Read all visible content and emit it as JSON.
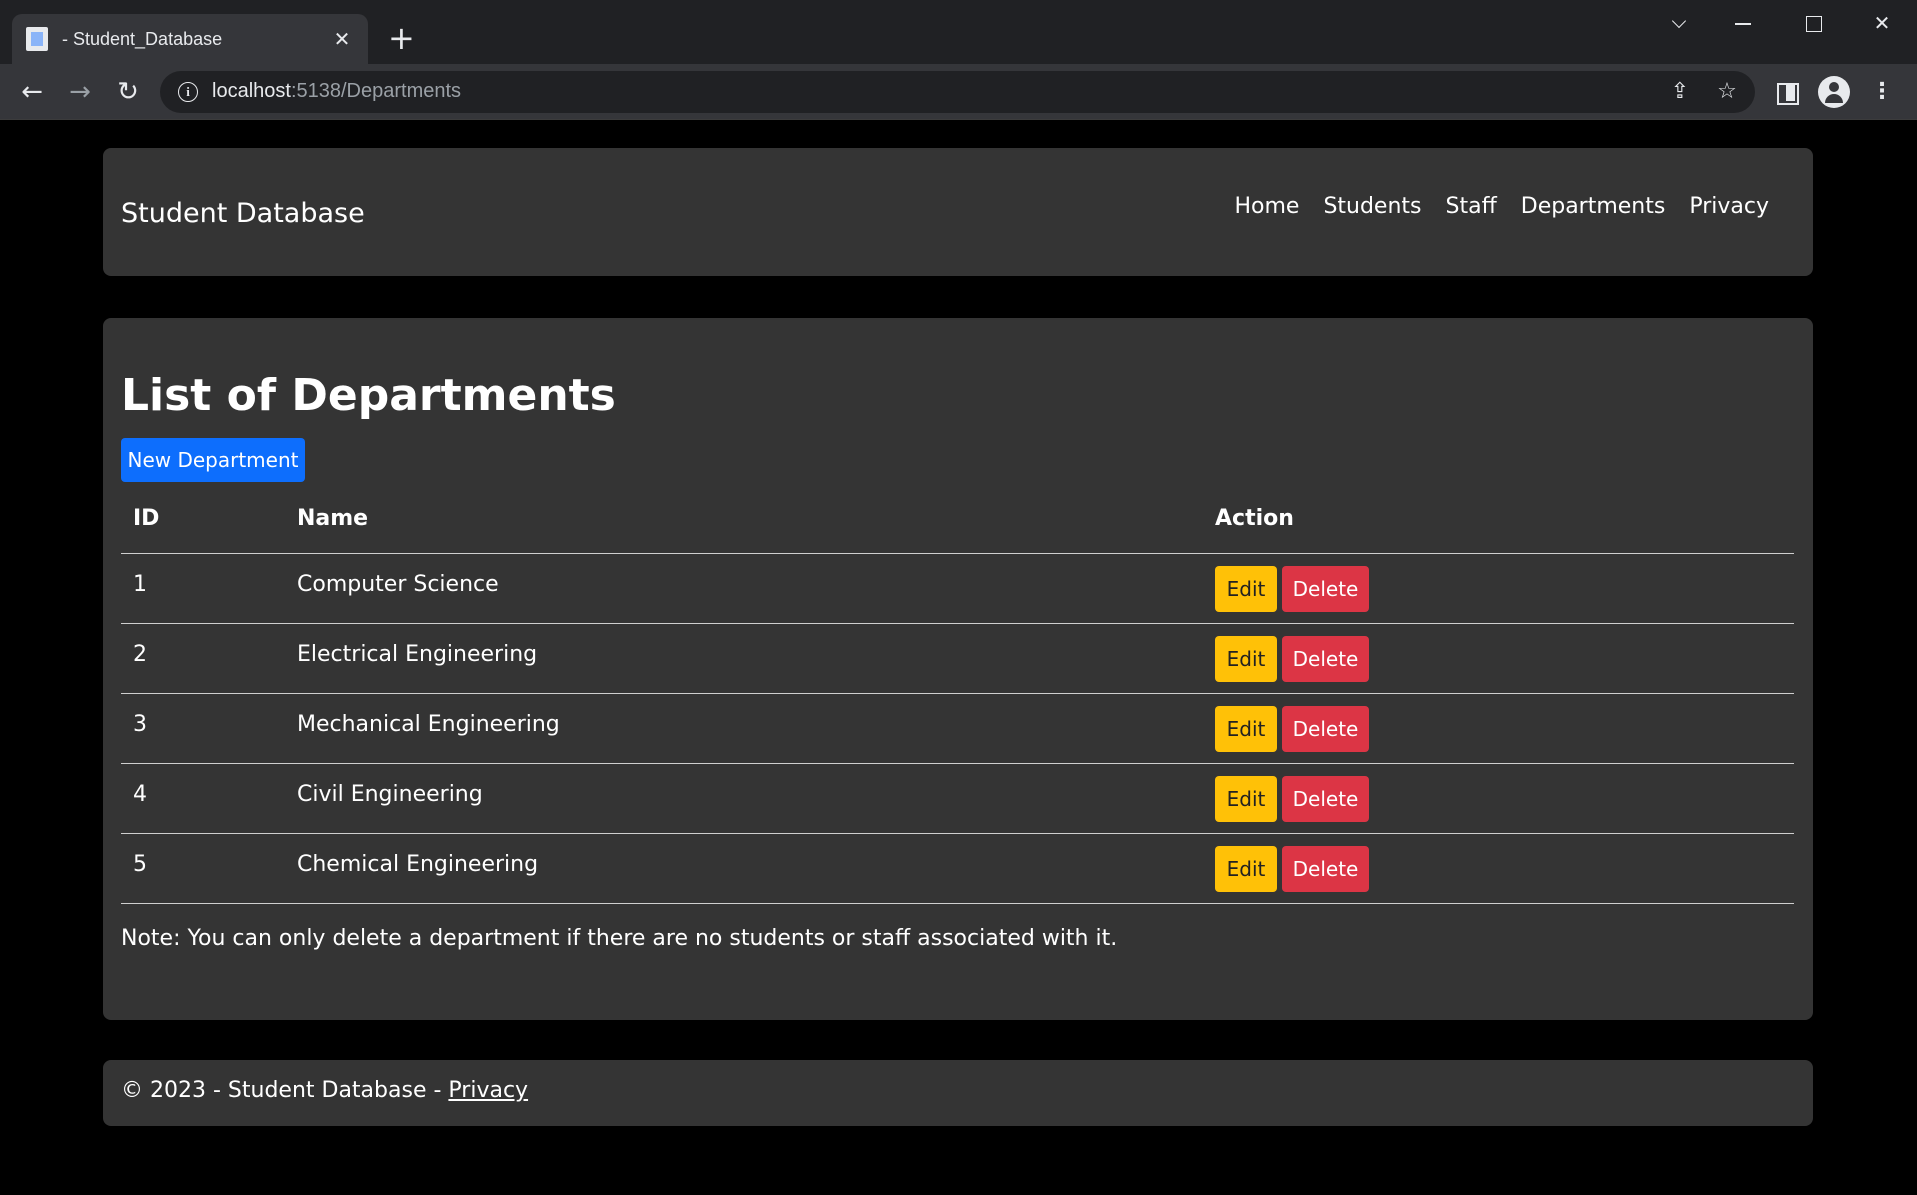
{
  "browser": {
    "tab_title": "- Student_Database",
    "tab_close": "✕",
    "new_tab": "+",
    "url_host": "localhost",
    "url_rest": ":5138/Departments",
    "icons": [
      "page-icon",
      "close-icon",
      "plus-icon",
      "back-icon",
      "forward-icon",
      "reload-icon",
      "info-icon",
      "share-icon",
      "star-icon",
      "side-panel-icon",
      "profile-icon",
      "menu-icon"
    ]
  },
  "navbar": {
    "brand": "Student Database",
    "links": [
      "Home",
      "Students",
      "Staff",
      "Departments",
      "Privacy"
    ]
  },
  "content": {
    "title": "List of Departments",
    "new_button": "New Department",
    "headers": {
      "id": "ID",
      "name": "Name",
      "action": "Action"
    },
    "rows": [
      {
        "id": "1",
        "name": "Computer Science",
        "edit": "Edit",
        "delete": "Delete"
      },
      {
        "id": "2",
        "name": "Electrical Engineering",
        "edit": "Edit",
        "delete": "Delete"
      },
      {
        "id": "3",
        "name": "Mechanical Engineering",
        "edit": "Edit",
        "delete": "Delete"
      },
      {
        "id": "4",
        "name": "Civil Engineering",
        "edit": "Edit",
        "delete": "Delete"
      },
      {
        "id": "5",
        "name": "Chemical Engineering",
        "edit": "Edit",
        "delete": "Delete"
      }
    ],
    "note": "Note: You can only delete a department if there are no students or staff associated with it."
  },
  "footer": {
    "text": "© 2023 - Student Database - ",
    "link": "Privacy"
  },
  "colors": {
    "primary": "#0d6efd",
    "warning": "#ffc107",
    "danger": "#dc3545",
    "panel": "#343434",
    "background": "#000000"
  }
}
